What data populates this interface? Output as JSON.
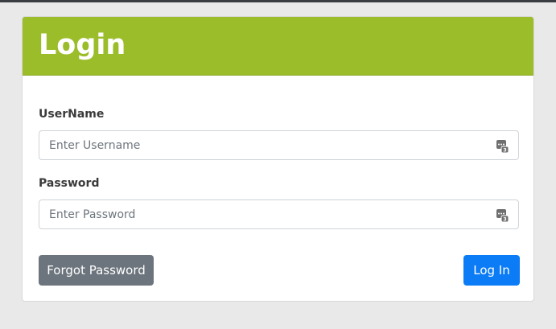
{
  "login": {
    "title": "Login",
    "username": {
      "label": "UserName",
      "placeholder": "Enter Username",
      "value": ""
    },
    "password": {
      "label": "Password",
      "placeholder": "Enter Password",
      "value": ""
    },
    "forgot_label": "Forgot Password",
    "login_label": "Log In"
  },
  "icons": {
    "field_icon": "password-manager-icon"
  },
  "colors": {
    "header": "#9bbd2a",
    "primary": "#0b7cf5",
    "secondary": "#6c757d",
    "background": "#e9e9e9"
  }
}
